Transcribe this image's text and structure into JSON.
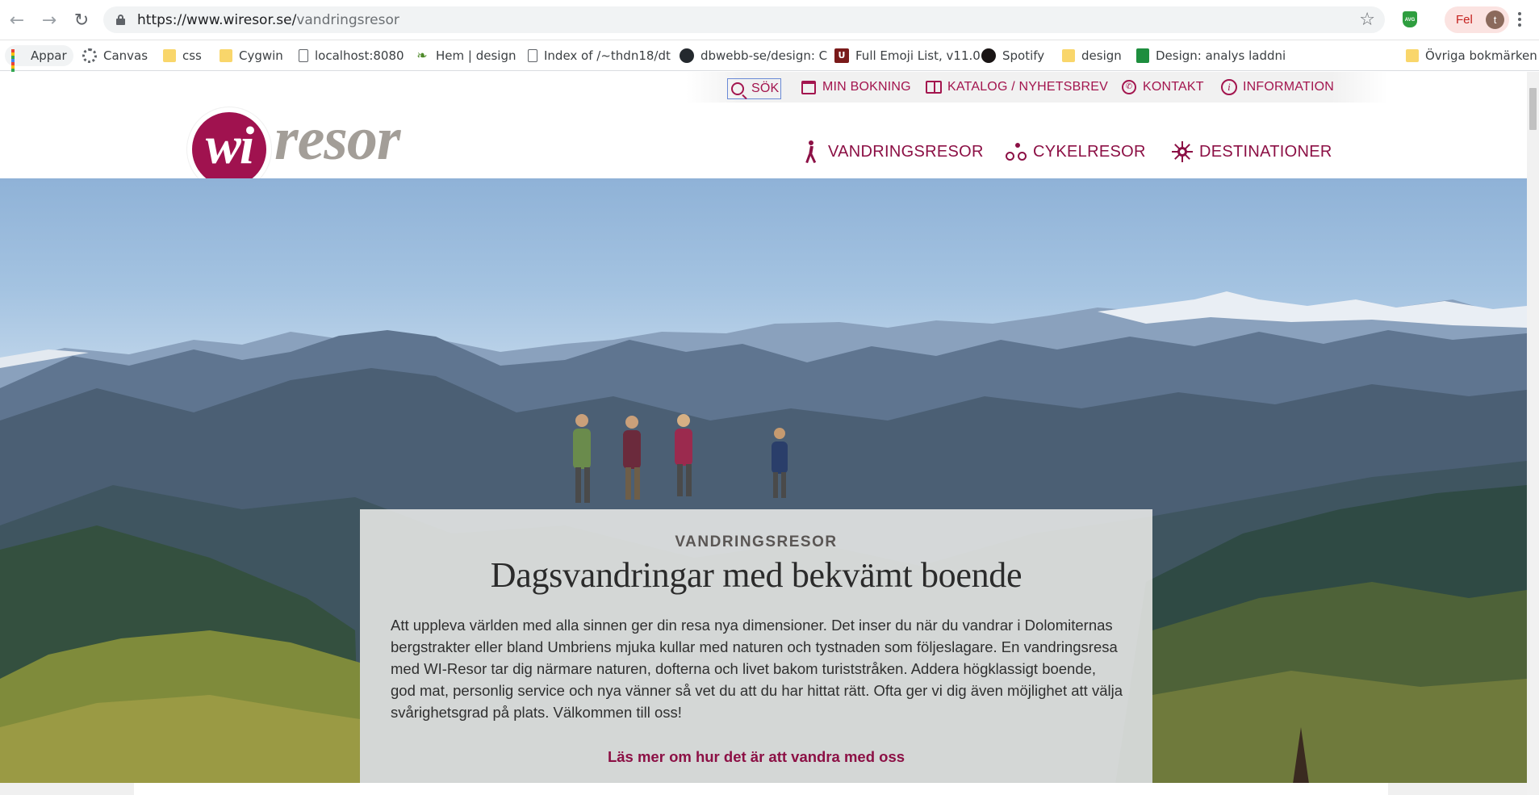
{
  "browser": {
    "url_host": "https://www.wiresor.se/",
    "url_path": "vandringsresor",
    "profile_label": "Fel",
    "profile_initial": "t",
    "extension_label": "AVG"
  },
  "bookmarks": [
    {
      "label": "Appar",
      "icon": "apps-grid-icon"
    },
    {
      "label": "Canvas",
      "icon": "canvas-icon"
    },
    {
      "label": "css",
      "icon": "folder-icon"
    },
    {
      "label": "Cygwin",
      "icon": "folder-icon"
    },
    {
      "label": "localhost:8080",
      "icon": "page-icon"
    },
    {
      "label": "Hem | design",
      "icon": "leaf-icon"
    },
    {
      "label": "Index of /~thdn18/dt",
      "icon": "page-icon"
    },
    {
      "label": "dbwebb-se/design: C",
      "icon": "github-icon"
    },
    {
      "label": "Full Emoji List, v11.0",
      "icon": "emoji-site-icon"
    },
    {
      "label": "Spotify",
      "icon": "spotify-icon"
    },
    {
      "label": "design",
      "icon": "folder-icon"
    },
    {
      "label": "Design: analys laddni",
      "icon": "sheets-icon"
    },
    {
      "label": "Övriga bokmärken",
      "icon": "folder-icon"
    }
  ],
  "utility_nav": [
    {
      "label": "SÖK",
      "icon": "search-icon"
    },
    {
      "label": "MIN BOKNING",
      "icon": "calendar-icon"
    },
    {
      "label": "KATALOG / NYHETSBREV",
      "icon": "book-icon"
    },
    {
      "label": "KONTAKT",
      "icon": "phone-icon"
    },
    {
      "label": "INFORMATION",
      "icon": "info-icon"
    }
  ],
  "logo": {
    "wi": "wi",
    "resor": "resor"
  },
  "main_nav": [
    {
      "label": "VANDRINGSRESOR",
      "icon": "hiker-icon"
    },
    {
      "label": "CYKELRESOR",
      "icon": "cyclist-icon"
    },
    {
      "label": "DESTINATIONER",
      "icon": "sun-icon"
    }
  ],
  "hero": {
    "kicker": "VANDRINGSRESOR",
    "title": "Dagsvandringar med bekvämt boende",
    "body": "Att uppleva världen med alla sinnen ger din resa nya dimensioner. Det inser du när du vandrar i Dolomiternas bergstrakter eller bland Umbriens mjuka kullar med naturen och tystnaden som följeslagare. En vandringsresa med WI-Resor tar dig närmare naturen, dofterna och livet bakom turiststråken. Addera högklassigt boende, god mat, personlig service och nya vänner så vet du att du har hittat rätt. Ofta ger vi dig även möjlighet att välja svårighetsgrad på plats. Välkommen till oss!",
    "link": "Läs mer om hur det är att vandra med oss"
  },
  "colors": {
    "brand": "#a0124f",
    "brand_text": "#8c1045",
    "logo_grey": "#a39e98"
  }
}
